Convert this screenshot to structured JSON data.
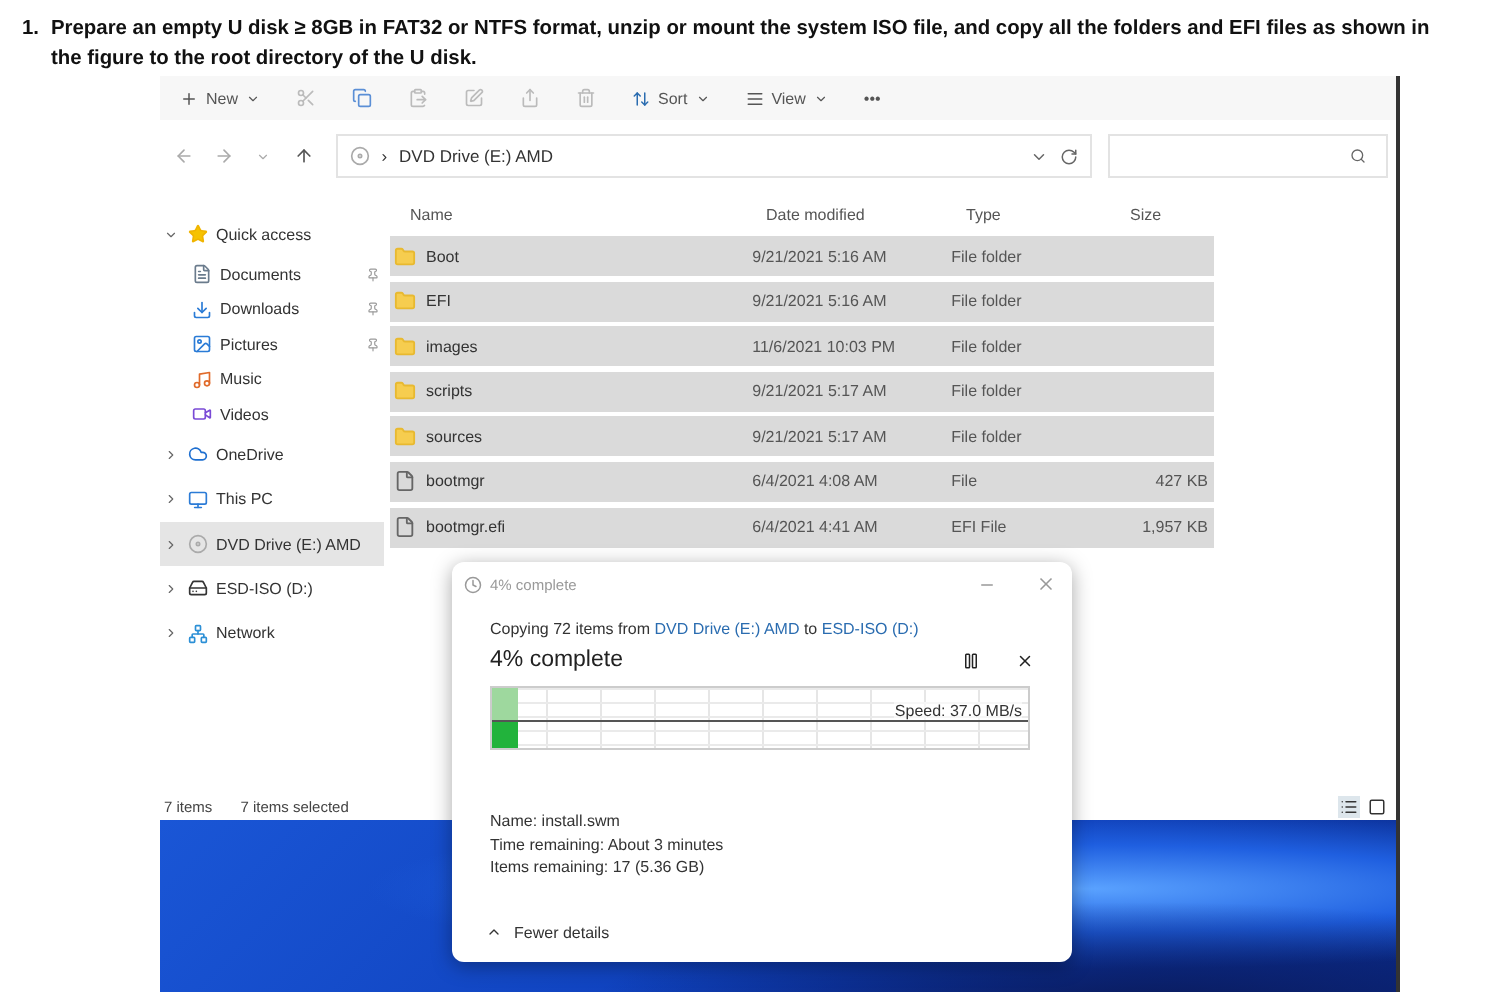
{
  "instruction": {
    "number": "1.",
    "text": "Prepare an empty U disk ≥ 8GB in FAT32 or NTFS format, unzip or mount the system ISO file, and copy all the folders and EFI files as shown in the figure to the root directory of the U disk."
  },
  "toolbar": {
    "new": "New",
    "sort": "Sort",
    "view": "View",
    "more": "•••"
  },
  "address": {
    "separator": "›",
    "path": "DVD Drive (E:) AMD"
  },
  "sidebar": [
    {
      "label": "Quick access",
      "expanded": true,
      "selected": false,
      "children": [
        {
          "label": "Documents",
          "pinned": true,
          "selected": false
        },
        {
          "label": "Downloads",
          "pinned": true,
          "selected": false
        },
        {
          "label": "Pictures",
          "pinned": true,
          "selected": false
        },
        {
          "label": "Music",
          "pinned": false,
          "selected": false
        },
        {
          "label": "Videos",
          "pinned": false,
          "selected": false
        }
      ]
    },
    {
      "label": "OneDrive",
      "expanded": false,
      "selected": false
    },
    {
      "label": "This PC",
      "expanded": false,
      "selected": false
    },
    {
      "label": "DVD Drive (E:) AMD",
      "expanded": false,
      "selected": true
    },
    {
      "label": "ESD-ISO (D:)",
      "expanded": false,
      "selected": false
    },
    {
      "label": "Network",
      "expanded": false,
      "selected": false
    }
  ],
  "columns": [
    "Name",
    "Date modified",
    "Type",
    "Size"
  ],
  "files": [
    {
      "kind": "folder",
      "name": "Boot",
      "date": "9/21/2021 5:16 AM",
      "type": "File folder",
      "selected": true
    },
    {
      "kind": "folder",
      "name": "EFI",
      "date": "9/21/2021 5:16 AM",
      "type": "File folder",
      "selected": true
    },
    {
      "kind": "folder",
      "name": "images",
      "date": "11/6/2021 10:03 PM",
      "type": "File folder",
      "selected": true
    },
    {
      "kind": "folder",
      "name": "scripts",
      "date": "9/21/2021 5:17 AM",
      "type": "File folder",
      "selected": true
    },
    {
      "kind": "folder",
      "name": "sources",
      "date": "9/21/2021 5:17 AM",
      "type": "File folder",
      "selected": true
    },
    {
      "kind": "file",
      "name": "bootmgr",
      "date": "6/4/2021 4:08 AM",
      "type": "File",
      "size": "427 KB",
      "selected": true
    },
    {
      "kind": "file",
      "name": "bootmgr.efi",
      "date": "6/4/2021 4:41 AM",
      "type": "EFI File",
      "size": "1,957 KB",
      "selected": true
    }
  ],
  "status": {
    "count": "7 items",
    "selection": "7 items selected"
  },
  "dialog": {
    "title": "4% complete",
    "prefix": "Copying 72 items from",
    "source": "DVD Drive (E:) AMD",
    "middle": "to",
    "destination": "ESD-ISO (D:)",
    "heading": "4% complete",
    "level": 0.05,
    "speed": "Speed: 37.0 MB/s",
    "details": [
      "Name: install.swm",
      "Time remaining: About 3 minutes",
      "Items remaining: 17 (5.36 GB)"
    ],
    "toggle": "Fewer details"
  }
}
